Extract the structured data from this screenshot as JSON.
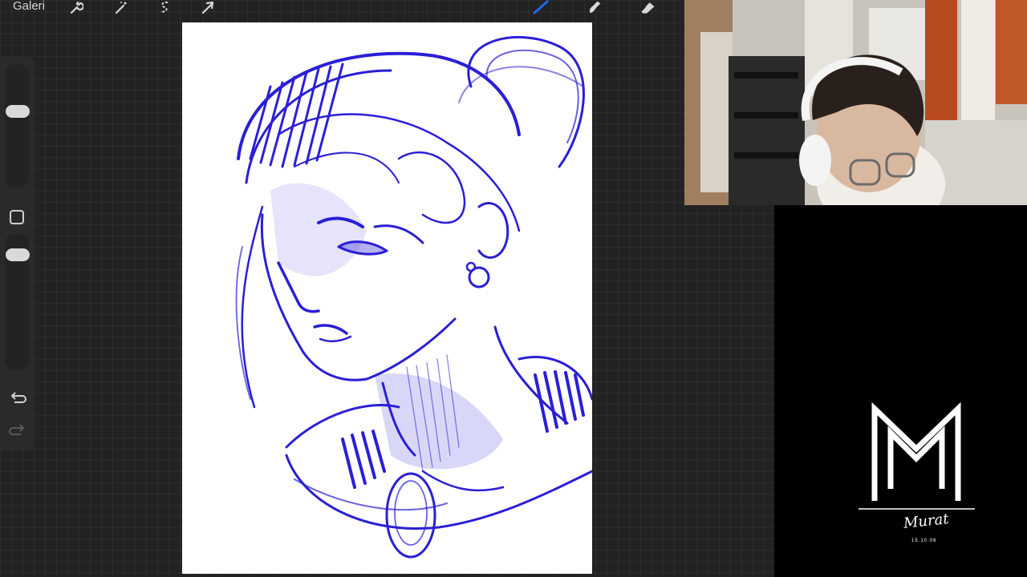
{
  "topbar": {
    "gallery_label": "Galeri",
    "tools": [
      {
        "name": "wrench-icon",
        "label": "Actions"
      },
      {
        "name": "magic-wand-icon",
        "label": "Adjustments"
      },
      {
        "name": "selection-icon",
        "label": "Selection"
      },
      {
        "name": "transform-arrow-icon",
        "label": "Transform"
      },
      {
        "name": "brush-icon",
        "label": "Paint"
      },
      {
        "name": "smudge-icon",
        "label": "Smudge"
      },
      {
        "name": "eraser-icon",
        "label": "Erase"
      }
    ]
  },
  "sidebar": {
    "brush_size_level": 0.72,
    "opacity_level": 0.86,
    "buttons": [
      "modify-button",
      "undo-button",
      "redo-button"
    ]
  },
  "canvas": {
    "ink_color": "#2a1fd6",
    "subject": "blue sketch portrait"
  },
  "branding": {
    "logo_letters": "MM",
    "signature": "Murat",
    "signature_date": "15.10.06"
  },
  "colors": {
    "accent_blue": "#1f6bff",
    "workspace_bg": "#222222",
    "panel_bg": "#000000"
  }
}
